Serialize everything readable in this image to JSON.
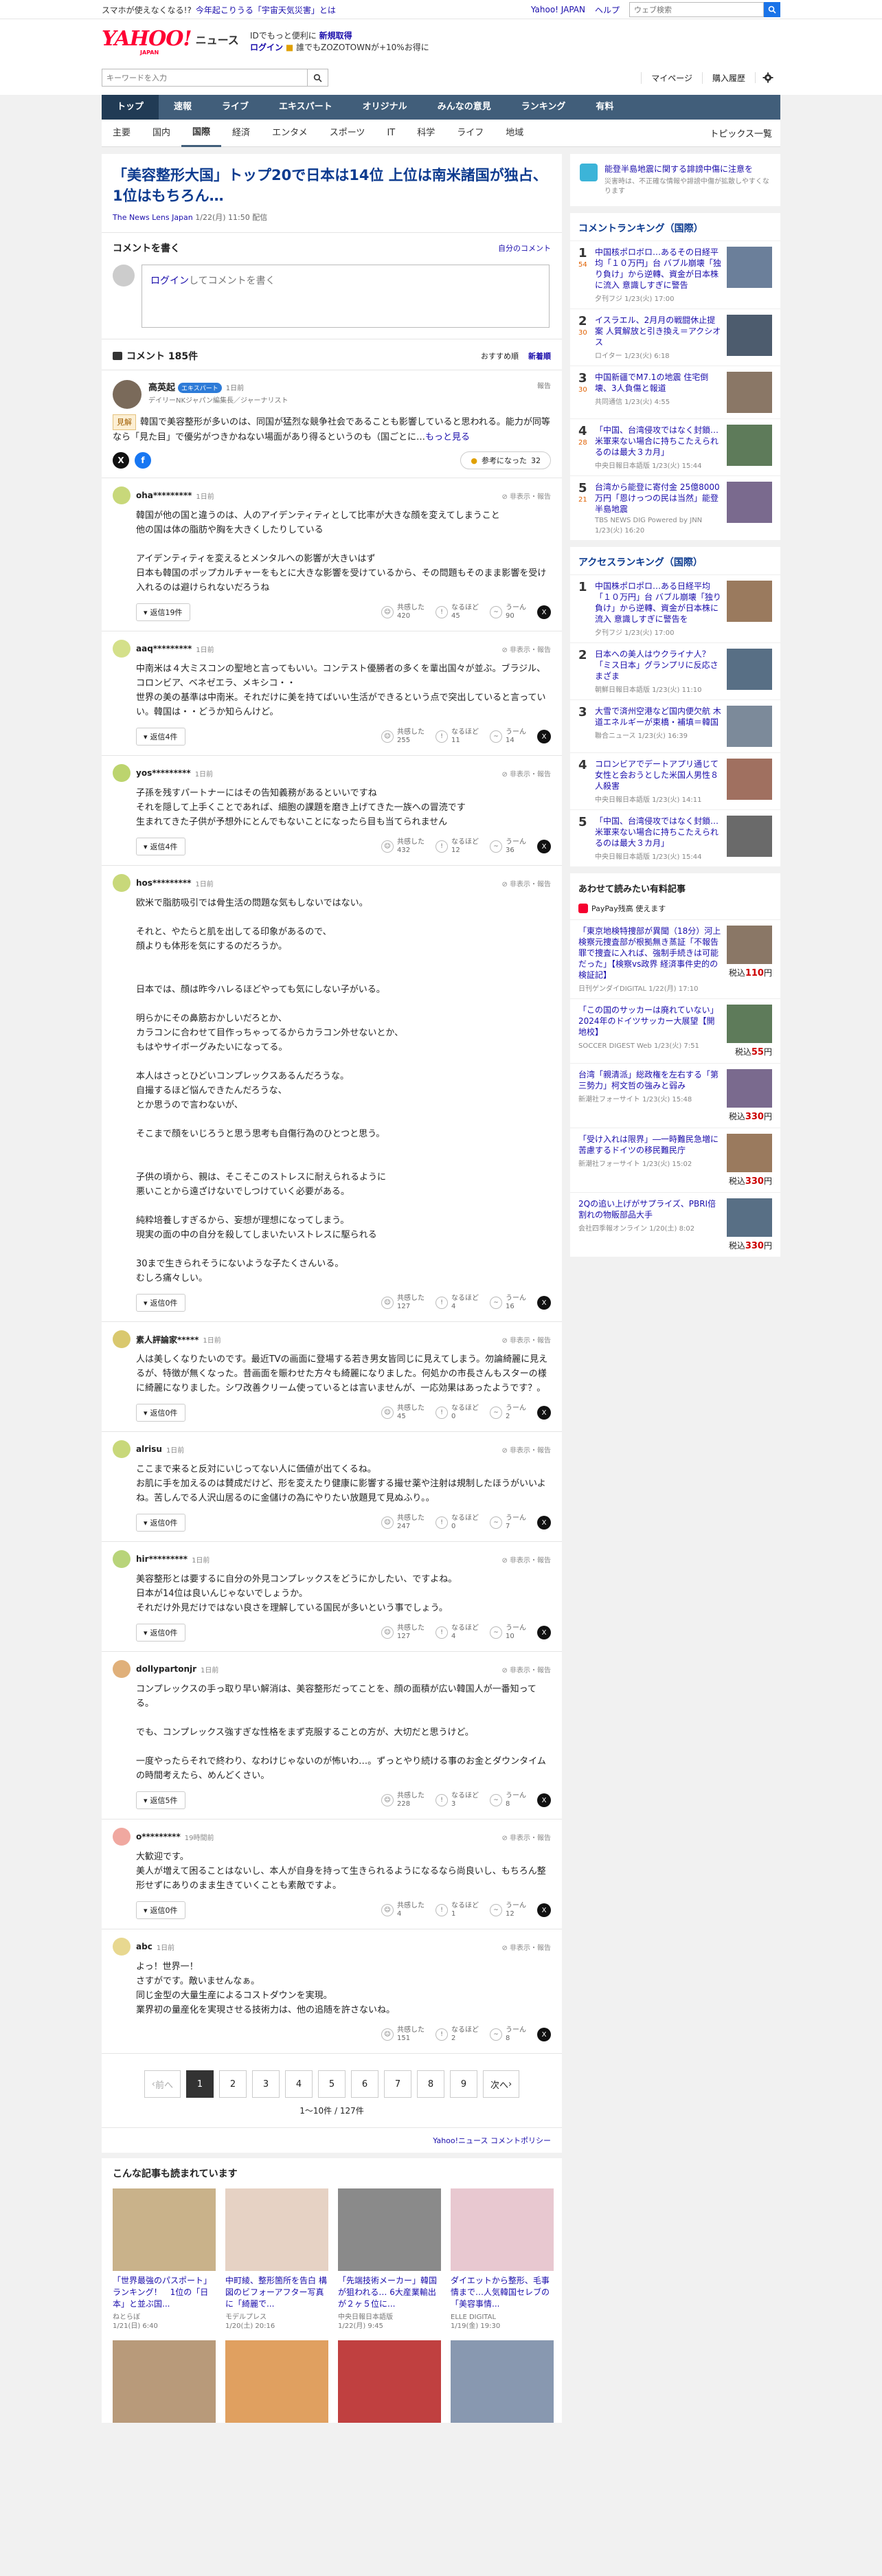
{
  "topbar": {
    "promo_text": "スマホが使えなくなる!?",
    "promo_link": "今年起こりうる「宇宙天気災害」とは",
    "links": [
      "Yahoo! JAPAN",
      "ヘルプ"
    ],
    "search_placeholder": "ウェブ検索"
  },
  "header": {
    "logo_text": "YAHOO!",
    "logo_sub": "JAPAN",
    "service": "ニュース",
    "promo_line1_a": "IDでもっと便利に",
    "promo_line1_b": "新規取得",
    "promo_line2_a": "ログイン",
    "promo_line2_b": "誰でもZOZOTOWNが+10%お得に"
  },
  "search": {
    "placeholder": "キーワードを入力",
    "links": [
      "マイページ",
      "購入履歴"
    ]
  },
  "global_nav": [
    "トップ",
    "速報",
    "ライブ",
    "エキスパート",
    "オリジナル",
    "みんなの意見",
    "ランキング",
    "有料"
  ],
  "sub_nav": [
    "主要",
    "国内",
    "国際",
    "経済",
    "エンタメ",
    "スポーツ",
    "IT",
    "科学",
    "ライフ",
    "地域"
  ],
  "sub_nav_active": 2,
  "topics_link": "トピックス一覧",
  "article": {
    "title": "「美容整形大国」トップ20で日本は14位 上位は南米諸国が独占、1位はもちろん…",
    "source": "The News Lens Japan",
    "date": "1/22(月) 11:50 配信"
  },
  "comment_write": {
    "title": "コメントを書く",
    "link": "自分のコメント",
    "login_link": "ログイン",
    "login_suffix": "してコメントを書く"
  },
  "comments_header": {
    "title": "コメント 185件",
    "sort_recommended": "おすすめ順",
    "sort_new": "新着順"
  },
  "expert": {
    "name": "高英起",
    "badge": "エキスパート",
    "time": "1日前",
    "role": "デイリーNKジャパン編集長／ジャーナリスト",
    "report": "報告",
    "tag": "見解",
    "text": "韓国で美容整形が多いのは、同国が猛烈な競争社会であることも影響していると思われる。能力が同等なら「見た目」で優劣がつきかねない場面があり得るというのも（国ごとに…",
    "more": "もっと見る",
    "helpful_label": "参考になった",
    "helpful_count": "32"
  },
  "comments": [
    {
      "name": "oha*********",
      "time": "1日前",
      "text": "韓国が他の国と違うのは、人のアイデンティティとして比率が大きな顔を変えてしまうこと\n他の国は体の脂肪や胸を大きくしたりしている\n\nアイデンティティを変えるとメンタルへの影響が大きいはず\n日本も韓国のポップカルチャーをもとに大きな影響を受けているから、その問題もそのまま影響を受け入れるのは避けられないだろうね",
      "replies": "返信19件",
      "agree": "420",
      "naruhodo": "45",
      "uun": "90"
    },
    {
      "name": "aaq*********",
      "time": "1日前",
      "text": "中南米は４大ミスコンの聖地と言ってもいい。コンテスト優勝者の多くを輩出国々が並ぶ。ブラジル、コロンビア、ベネゼエラ、メキシコ・・\n世界の美の基準は中南米。それだけに美を持てばいい生活ができるという点で突出していると言っていい。韓国は・・どうか知らんけど。",
      "replies": "返信4件",
      "agree": "255",
      "naruhodo": "11",
      "uun": "14"
    },
    {
      "name": "yos*********",
      "time": "1日前",
      "text": "子孫を残すパートナーにはその告知義務があるといいですね\nそれを隠して上手くことであれば、細胞の課題を磨き上げてきた一族への冒涜です\n生まれてきた子供が予想外にとんでもないことになったら目も当てられません",
      "replies": "返信4件",
      "agree": "432",
      "naruhodo": "12",
      "uun": "36"
    },
    {
      "name": "hos*********",
      "time": "1日前",
      "text": "欧米で脂肪吸引では骨生活の問題な気もしないではない。\n\nそれと、やたらと肌を出してる印象があるので、\n顔よりも体形を気にするのだろうか。\n\n\n日本では、顔は昨今ハレるほどやっても気にしない子がいる。\n\n明らかにその鼻筋おかしいだろとか、\nカラコンに合わせて目作っちゃってるからカラコン外せないとか、\nもはやサイボーグみたいになってる。\n\n本人はさっとひどいコンプレックスあるんだろうな。\n自撮するほど悩んできたんだろうな、\nとか思うので言わないが、\n\nそこまで顔をいじろうと思う思考も自傷行為のひとつと思う。\n\n\n子供の頃から、親は、そこそこのストレスに耐えられるように\n悪いことから遠ざけないでしつけていく必要がある。\n\n純粋培養しすぎるから、妄想が理想になってしまう。\n現実の面の中の自分を殺してしまいたいストレスに駆られる\n\n30まで生きられそうにないような子たくさんいる。\nむしろ痛々しい。",
      "replies": "返信0件",
      "agree": "127",
      "naruhodo": "4",
      "uun": "16"
    },
    {
      "name": "素人評論家*****",
      "time": "1日前",
      "text": "人は美しくなりたいのです。最近TVの画面に登場する若き男女皆同じに見えてしまう。勿論綺麗に見えるが、特徴が無くなった。昔画面を賑わせた方々も綺麗になりました。何処かの市長さんもスターの様に綺麗になりました。シワ改善クリーム使っているとは言いませんが、一応効果はあったようです？。",
      "replies": "返信0件",
      "agree": "45",
      "naruhodo": "0",
      "uun": "2"
    },
    {
      "name": "alrisu",
      "time": "1日前",
      "text": "ここまで来ると反対にいじってない人に価値が出てくるね。\nお肌に手を加えるのは賛成だけど、形を変えたり健康に影響する撮せ薬や注射は規制したほうがいいよね。苦しんでる人沢山居るのに金儲けの為にやりたい放題見て見ぬふり。。",
      "replies": "返信0件",
      "agree": "247",
      "naruhodo": "0",
      "uun": "7"
    },
    {
      "name": "hir*********",
      "time": "1日前",
      "text": "美容整形とは要するに自分の外見コンプレックスをどうにかしたい、ですよね。\n日本が14位は良いんじゃないでしょうか。\nそれだけ外見だけではない良さを理解している国民が多いという事でしょう。",
      "replies": "返信0件",
      "agree": "127",
      "naruhodo": "4",
      "uun": "10"
    },
    {
      "name": "dollypartonjr",
      "time": "1日前",
      "text": "コンプレックスの手っ取り早い解消は、美容整形だってことを、顔の面積が広い韓国人が一番知ってる。\n\nでも、コンプレックス強すぎな性格をまず克服することの方が、大切だと思うけど。\n\n一度やったらそれで終わり、なわけじゃないのが怖いわ…。ずっとやり続ける事のお金とダウンタイムの時間考えたら、めんどくさい。",
      "replies": "返信5件",
      "agree": "228",
      "naruhodo": "3",
      "uun": "8"
    },
    {
      "name": "o*********",
      "time": "19時間前",
      "text": "大歓迎です。\n美人が増えて困ることはないし、本人が自身を持って生きられるようになるなら尚良いし、もちろん整形せずにありのまま生きていくことも素敵ですよ。",
      "replies": "返信0件",
      "agree": "4",
      "naruhodo": "1",
      "uun": "12"
    },
    {
      "name": "abc",
      "time": "1日前",
      "text": "よっ！世界一！\nさすがです。敵いませんなぁ。\n同じ金型の大量生産によるコストダウンを実現。\n業界初の量産化を実現させる技術力は、他の追随を許さないね。",
      "replies": "",
      "agree": "151",
      "naruhodo": "2",
      "uun": "8"
    }
  ],
  "reaction_labels": {
    "agree": "共感した",
    "naruhodo": "なるほど",
    "uun": "うーん"
  },
  "comment_action": "非表示・報告",
  "pager": {
    "prev": "前へ",
    "pages": [
      "1",
      "2",
      "3",
      "4",
      "5",
      "6",
      "7",
      "8",
      "9"
    ],
    "next": "次へ",
    "current": "1",
    "count": "1〜10件 / 127件"
  },
  "policy_link": "Yahoo!ニュース コメントポリシー",
  "recommend": {
    "title": "こんな記事も読まれています",
    "items": [
      {
        "title": "「世界最強のパスポート」ランキング！　1位の「日本」と並ぶ国...",
        "source": "ねとらぼ",
        "date": "1/21(日) 6:40"
      },
      {
        "title": "中町綾、整形箇所を告白 構図のビフォーアフター写真に「綺麗で...",
        "source": "モデルプレス",
        "date": "1/20(土) 20:16"
      },
      {
        "title": "「先端技術メーカー」韓国が狙われる… 6大産業輸出が２ヶ５位に...",
        "source": "中央日報日本語版",
        "date": "1/22(月) 9:45"
      },
      {
        "title": "ダイエットから整形、毛事情まで…人気韓国セレブの「美容事情...",
        "source": "ELLE DIGITAL",
        "date": "1/19(金) 19:30"
      }
    ]
  },
  "side": {
    "notice_title": "能登半島地震に関する誹謗中傷に注意を",
    "notice_sub": "災害時は、不正確な情報や誹謗中傷が拡散しやすくなります",
    "comment_ranking_title": "コメントランキング（国際）",
    "comment_ranking": [
      {
        "no": "1",
        "count": "54",
        "title": "中国核ポロボロ…あるその日経平均「１０万円」台 バブル崩壊「独り負け」から逆轉、資金が日本株に流入 意識しすぎに警告",
        "source": "夕刊フジ 1/23(火) 17:00"
      },
      {
        "no": "2",
        "count": "30",
        "title": "イスラエル、2月月の戦闘休止提案 人質解放と引き換え＝アクシオス",
        "source": "ロイター 1/23(火) 6:18"
      },
      {
        "no": "3",
        "count": "30",
        "title": "中国新疆でM7.1の地震 住宅倒壊、3人負傷と報道",
        "source": "共同通信 1/23(火) 4:55"
      },
      {
        "no": "4",
        "count": "28",
        "title": "「中国、台湾侵攻ではなく封鎖…米軍来ない場合に持ちこたえられるのは最大３カ月」",
        "source": "中央日報日本語版 1/23(火) 15:44"
      },
      {
        "no": "5",
        "count": "21",
        "title": "台湾から能登に寄付金 25億8000万円「恩けっつの民は当然」能登半島地震",
        "source": "TBS NEWS DIG Powered by JNN 1/23(火) 16:20"
      }
    ],
    "access_ranking_title": "アクセスランキング（国際）",
    "access_ranking": [
      {
        "no": "1",
        "title": "中国株ポロポロ…ある日経平均「１０万円」台 バブル崩壊「独り負け」から逆轉、資金が日本株に流入 意識しすぎに警告を",
        "source": "夕刊フジ 1/23(火) 17:00"
      },
      {
        "no": "2",
        "title": "日本への美人はウクライナ人？「ミス日本」グランプリに反応さまざま",
        "source": "朝鮮日報日本語版 1/23(火) 11:10"
      },
      {
        "no": "3",
        "title": "大雪で済州空港など国内便欠航 木道エネルギーが束橋・補填＝韓国",
        "source": "聯合ニュース 1/23(火) 16:39"
      },
      {
        "no": "4",
        "title": "コロンビアでデートアプリ通じて女性と会おうとした米国人男性８人殺害",
        "source": "中央日報日本語版 1/23(火) 14:11"
      },
      {
        "no": "5",
        "title": "「中国、台湾侵攻ではなく封鎖…米軍来ない場合に持ちこたえられるのは最大３カ月」",
        "source": "中央日報日本語版 1/23(火) 15:44"
      }
    ],
    "ads_title": "あわせて読みたい有料記事",
    "paypay": "PayPay残高 使えます",
    "ads": [
      {
        "title": "「東京地検特捜部が異聞（18分）河上検察元捜査部が根拠無き蒸証「不報告罪で捜査に入れば、強制手続きは可能だった」【検察vs政界 経済事件史的の検証記】",
        "source": "日刊ゲンダイDIGITAL 1/22(月) 17:10",
        "price": "110"
      },
      {
        "title": "「この国のサッカーは廃れていない」2024年のドイツサッカー大展望【開地校】",
        "source": "SOCCER DIGEST Web 1/23(火) 7:51",
        "price": "55"
      },
      {
        "title": "台湾「親清派」総政権を左右する「第三勢力」柯文哲の強みと弱み",
        "source": "新潮社フォーサイト 1/23(火) 15:48",
        "price": "330"
      },
      {
        "title": "「受け入れは限界」―一時難民急増に苦慮するドイツの移民難民庁",
        "source": "新潮社フォーサイト 1/23(火) 15:02",
        "price": "330"
      },
      {
        "title": "2Qの追い上げがサプライズ、PBRI倍割れの物販部品大手",
        "source": "会社四季報オンライン 1/20(土) 8:02",
        "price": "330"
      }
    ],
    "price_prefix": "税込",
    "price_suffix": "円"
  },
  "colors": {
    "nav": "#415e7a",
    "nav_active": "#213b55",
    "link": "#1a0dab",
    "title": "#0d3b8f",
    "brand": "#ff0033"
  }
}
